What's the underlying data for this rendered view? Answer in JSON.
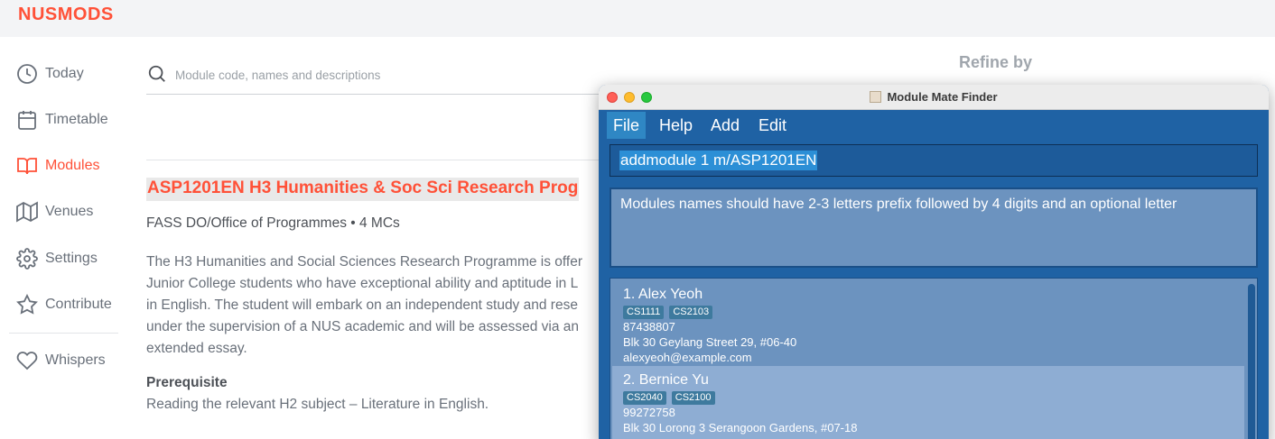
{
  "app": {
    "logo": "NUSMODS",
    "accent": "#ff5138"
  },
  "sidebar": {
    "items": [
      {
        "label": "Today",
        "icon": "clock-icon"
      },
      {
        "label": "Timetable",
        "icon": "calendar-icon"
      },
      {
        "label": "Modules",
        "icon": "book-icon",
        "active": true
      },
      {
        "label": "Venues",
        "icon": "map-icon"
      },
      {
        "label": "Settings",
        "icon": "gear-icon"
      },
      {
        "label": "Contribute",
        "icon": "star-icon"
      },
      {
        "label": "Whispers",
        "icon": "heart-icon"
      }
    ]
  },
  "search": {
    "placeholder": "Module code, names and descriptions",
    "value": ""
  },
  "refine": {
    "label": "Refine by"
  },
  "module": {
    "title": "ASP1201EN H3 Humanities & Soc Sci Research Prog",
    "meta": "FASS DO/Office of Programmes • 4 MCs",
    "description_lines": [
      "The H3 Humanities and Social Sciences Research Programme is offer",
      "Junior College students who have exceptional ability and aptitude in L",
      "in English. The student will embark on an independent study and rese",
      "under the supervision of a NUS academic and will be assessed via an",
      "extended essay."
    ],
    "prerequisite_heading": "Prerequisite",
    "prerequisite_text": "Reading the relevant H2 subject – Literature in English."
  },
  "finder": {
    "window_title": "Module Mate Finder",
    "menu": [
      {
        "label": "File",
        "active": true
      },
      {
        "label": "Help"
      },
      {
        "label": "Add"
      },
      {
        "label": "Edit"
      }
    ],
    "command": "addmodule 1 m/ASP1201EN",
    "result": "Modules names should have 2-3 letters prefix followed by 4 digits and an optional letter",
    "persons": [
      {
        "name": "1.  Alex Yeoh",
        "modules": [
          "CS1111",
          "CS2103"
        ],
        "phone": "87438807",
        "address": "Blk 30 Geylang Street 29, #06-40",
        "email": "alexyeoh@example.com"
      },
      {
        "name": "2.  Bernice Yu",
        "modules": [
          "CS2040",
          "CS2100"
        ],
        "phone": "99272758",
        "address": "Blk 30 Lorong 3 Serangoon Gardens, #07-18",
        "email": ""
      }
    ]
  }
}
